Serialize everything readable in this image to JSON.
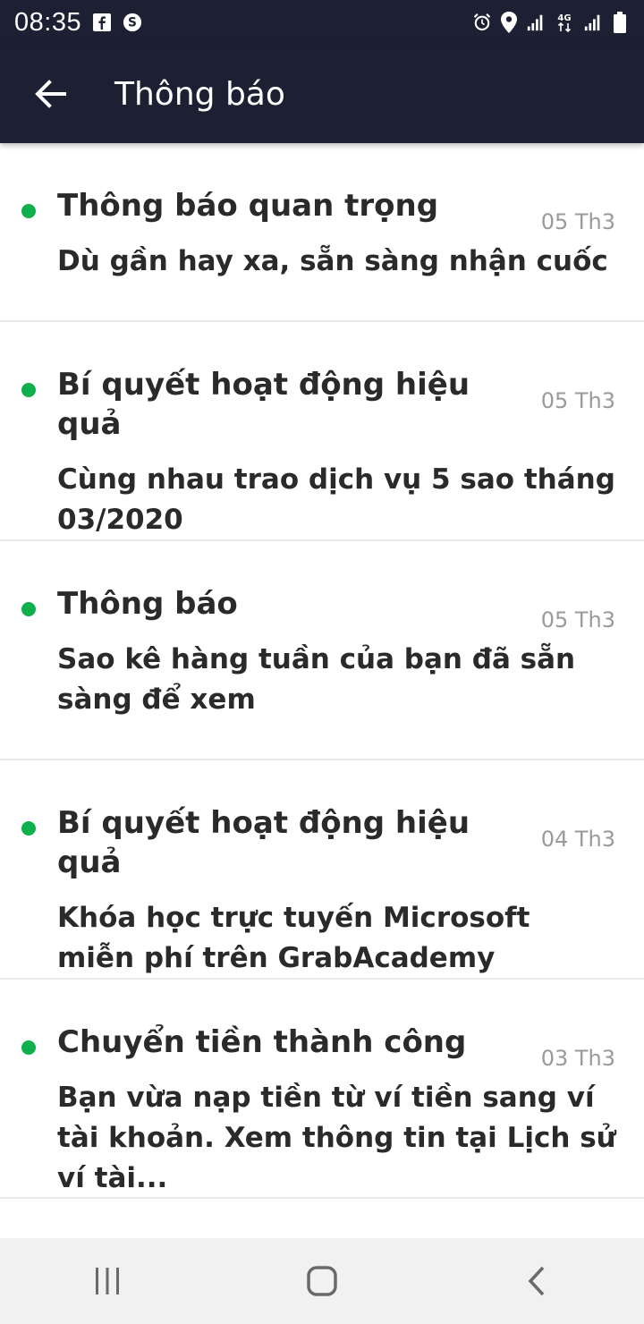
{
  "status_bar": {
    "time": "08:35",
    "left_icons": [
      "facebook-icon",
      "skype-icon"
    ],
    "right_icons": [
      "alarm-icon",
      "location-icon",
      "signal-icon",
      "network-4g-icon",
      "signal-icon",
      "battery-icon"
    ],
    "network": "4G"
  },
  "app_bar": {
    "back_icon": "arrow-left-icon",
    "title": "Thông báo"
  },
  "notifications": [
    {
      "title": "Thông báo quan trọng",
      "date": "05 Th3",
      "body": "Dù gần hay xa, sẵn sàng nhận cuốc",
      "unread": true
    },
    {
      "title": "Bí quyết hoạt động hiệu quả",
      "date": "05 Th3",
      "body": "Cùng nhau trao dịch vụ 5 sao tháng 03/2020",
      "unread": true
    },
    {
      "title": "Thông báo",
      "date": "05 Th3",
      "body": "Sao kê hàng tuần của bạn đã sẵn sàng để xem",
      "unread": true
    },
    {
      "title": "Bí quyết hoạt động hiệu quả",
      "date": "04 Th3",
      "body": "Khóa học trực tuyến Microsoft miễn phí trên GrabAcademy",
      "unread": true
    },
    {
      "title": "Chuyển tiền thành công",
      "date": "03 Th3",
      "body": "Bạn vừa nạp tiền từ ví tiền sang ví tài khoản. Xem thông tin tại Lịch sử ví tài...",
      "unread": true
    }
  ],
  "nav_bar": {
    "buttons": [
      "recent-apps-icon",
      "home-icon",
      "back-icon"
    ]
  },
  "colors": {
    "header_bg": "#1d2033",
    "unread_dot": "#0fb04b",
    "date_text": "#9a9a9a",
    "divider": "#e9e9e9",
    "nav_bg": "#f1f1f1"
  }
}
